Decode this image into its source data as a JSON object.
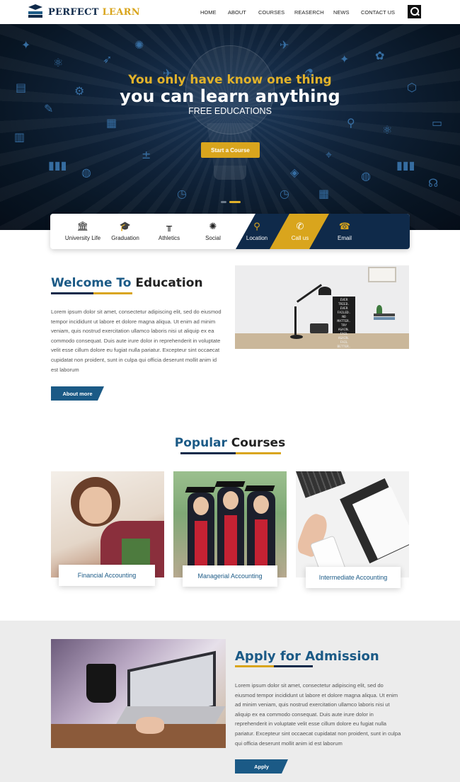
{
  "logo": {
    "part1": "PERFECT",
    "part2": "LEARN"
  },
  "nav": {
    "items": [
      "HOME",
      "ABOUT",
      "COURSES",
      "REASERCH",
      "NEWS",
      "CONTACT US"
    ]
  },
  "hero": {
    "line1": "You only have know one thing",
    "line2": "you can learn anything",
    "line3": "FREE EDUCATIONS",
    "cta": "Start a Course"
  },
  "features": {
    "items": [
      {
        "label": "University Life",
        "icon": "building-icon"
      },
      {
        "label": "Graduation",
        "icon": "graduation-cap-icon"
      },
      {
        "label": "Athletics",
        "icon": "hurdle-icon"
      },
      {
        "label": "Social",
        "icon": "social-network-icon"
      },
      {
        "label": "Location",
        "icon": "map-pin-icon"
      },
      {
        "label": "Call us",
        "icon": "phone-icon"
      },
      {
        "label": "Email",
        "icon": "telephone-icon"
      }
    ]
  },
  "welcome": {
    "title_a": "Welcome To",
    "title_b": "Education",
    "body": "Lorem ipsum dolor sit amet, consectetur adipiscing elit, sed do eiusmod tempor incididunt ut labore et dolore magna aliqua. Ut enim ad minim veniam, quis nostrud exercitation ullamco laboris nisi ut aliquip ex ea commodo consequat. Duis aute irure dolor in reprehenderit in voluptate velit esse cillum dolore eu fugiat nulla pariatur. Excepteur sint occaecat cupidatat non proident, sunt in culpa qui officia deserunt mollit anim id est laborum",
    "button": "About more",
    "sign_text": "EVER TRIED. EVER FAILED. NO MATTER. TRY AGAIN. FAIL AGAIN. FAIL BETTER."
  },
  "courses": {
    "title_a": "Popular",
    "title_b": "Courses",
    "items": [
      "Financial Accounting",
      "Managerial Accounting",
      "Intermediate Accounting"
    ]
  },
  "admission": {
    "title": "Apply for Admission",
    "body": "Lorem ipsum dolor sit amet, consectetur adipiscing elit, sed do eiusmod tempor incididunt ut labore et dolore magna aliqua. Ut enim ad minim veniam, quis nostrud exercitation ullamco laboris nisi ut aliquip ex ea commodo consequat. Duis aute irure dolor in reprehenderit in voluptate velit esse cillum dolore eu fugiat nulla pariatur. Excepteur sint occaecat cupidatat non proident, sunt in culpa qui officia deserunt mollit anim id est laborum",
    "button": "Apply"
  },
  "colors": {
    "navy": "#0f2a4a",
    "blue": "#1b5a86",
    "gold": "#d9a51d"
  }
}
